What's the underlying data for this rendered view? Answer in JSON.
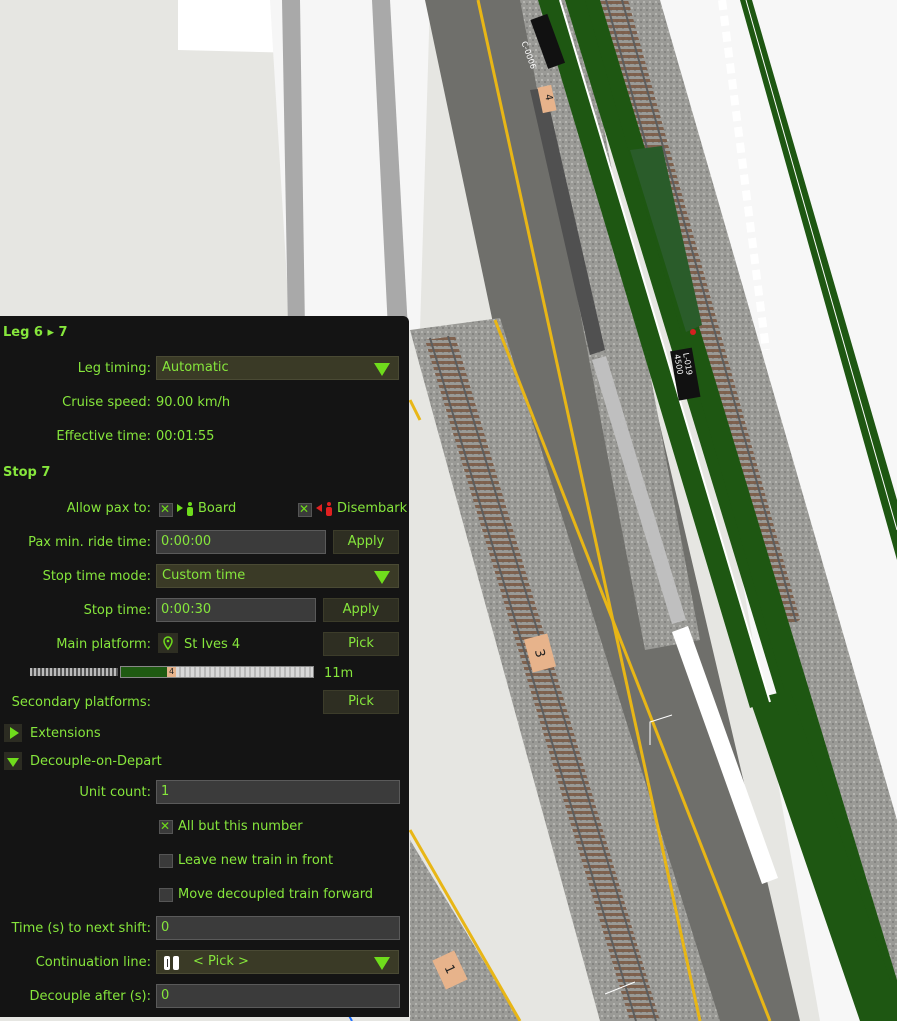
{
  "map": {
    "train_tags": [
      "C-0006",
      "L-019\n4500"
    ],
    "platform_numbers": [
      "4",
      "3",
      "1"
    ]
  },
  "panel": {
    "leg_header": "Leg 6 ▸ 7",
    "leg_timing_label": "Leg timing:",
    "leg_timing_value": "Automatic",
    "cruise_speed_label": "Cruise speed:",
    "cruise_speed_value": "90.00 km/h",
    "effective_time_label": "Effective time:",
    "effective_time_value": "00:01:55",
    "stop_header": "Stop 7",
    "allow_pax_label": "Allow pax to:",
    "board_label": "Board",
    "board_checked": true,
    "disembark_label": "Disembark",
    "disembark_checked": true,
    "pax_min_ride_label": "Pax min. ride time:",
    "pax_min_ride_value": "0:00:00",
    "apply_label": "Apply",
    "stop_time_mode_label": "Stop time mode:",
    "stop_time_mode_value": "Custom time",
    "stop_time_label": "Stop time:",
    "stop_time_value": "0:00:30",
    "main_platform_label": "Main platform:",
    "main_platform_value": "St Ives 4",
    "pick_label": "Pick",
    "platform_bar_number": "4",
    "platform_length": "11m",
    "secondary_platforms_label": "Secondary platforms:",
    "extensions_label": "Extensions",
    "decouple_label": "Decouple-on-Depart",
    "unit_count_label": "Unit count:",
    "unit_count_value": "1",
    "all_but_label": "All but this number",
    "all_but_checked": true,
    "leave_front_label": "Leave new train in front",
    "leave_front_checked": false,
    "move_forward_label": "Move decoupled train forward",
    "move_forward_checked": false,
    "time_next_shift_label": "Time (s) to next shift:",
    "time_next_shift_value": "0",
    "continuation_label": "Continuation line:",
    "continuation_value": "< Pick >",
    "decouple_after_label": "Decouple after (s):",
    "decouple_after_value": "0"
  },
  "colors": {
    "accent_green": "#86e63c",
    "panel_bg": "#141414",
    "track_green": "#1f5a12"
  }
}
